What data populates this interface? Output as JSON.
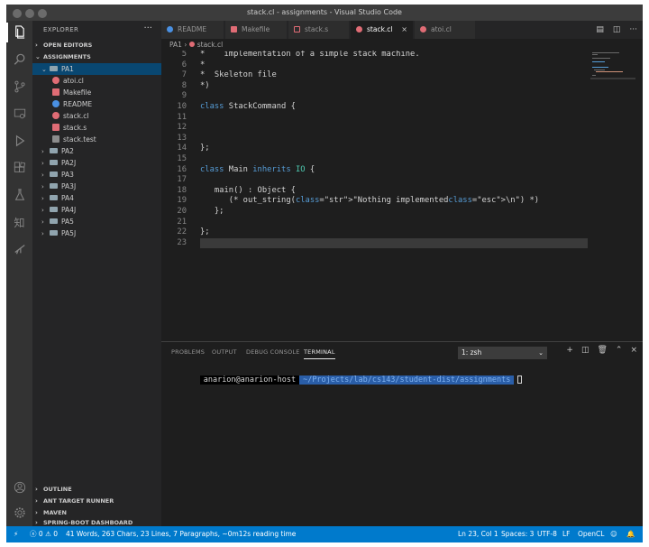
{
  "window": {
    "title": "stack.cl - assignments - Visual Studio Code"
  },
  "sidebar": {
    "title": "EXPLORER",
    "more": "···",
    "sections": {
      "open_editors": "OPEN EDITORS",
      "assignments": "ASSIGNMENTS"
    },
    "tree": [
      {
        "label": "PA1",
        "type": "folder",
        "expanded": true,
        "depth": 1
      },
      {
        "label": "atoi.cl",
        "type": "cool",
        "depth": 2
      },
      {
        "label": "Makefile",
        "type": "makefile",
        "depth": 2
      },
      {
        "label": "README",
        "type": "info",
        "depth": 2
      },
      {
        "label": "stack.cl",
        "type": "cool",
        "depth": 2
      },
      {
        "label": "stack.s",
        "type": "asm",
        "depth": 2
      },
      {
        "label": "stack.test",
        "type": "text",
        "depth": 2
      },
      {
        "label": "PA2",
        "type": "folder",
        "depth": 1
      },
      {
        "label": "PA2J",
        "type": "folder",
        "depth": 1
      },
      {
        "label": "PA3",
        "type": "folder",
        "depth": 1
      },
      {
        "label": "PA3J",
        "type": "folder",
        "depth": 1
      },
      {
        "label": "PA4",
        "type": "folder",
        "depth": 1
      },
      {
        "label": "PA4J",
        "type": "folder",
        "depth": 1
      },
      {
        "label": "PA5",
        "type": "folder",
        "depth": 1
      },
      {
        "label": "PA5J",
        "type": "folder",
        "depth": 1
      }
    ],
    "bottom_sections": [
      "OUTLINE",
      "ANT TARGET RUNNER",
      "MAVEN",
      "SPRING-BOOT DASHBOARD"
    ]
  },
  "tabs": [
    {
      "label": "README",
      "icon": "info-icon",
      "active": false
    },
    {
      "label": "Makefile",
      "icon": "makefile-icon",
      "active": false
    },
    {
      "label": "stack.s",
      "icon": "asm-icon",
      "active": false
    },
    {
      "label": "stack.cl",
      "icon": "cool-file-icon",
      "active": true
    },
    {
      "label": "atoi.cl",
      "icon": "cool-file-icon",
      "active": false
    }
  ],
  "tab_close": "×",
  "breadcrumb": {
    "folder": "PA1",
    "sep": "›",
    "file": "stack.cl"
  },
  "editor": {
    "current_line": 23,
    "lines": [
      {
        "n": "5",
        "text": "*    implementation of a simple stack machine."
      },
      {
        "n": "6",
        "text": "*"
      },
      {
        "n": "7",
        "text": "*  Skeleton file"
      },
      {
        "n": "8",
        "text": "*)"
      },
      {
        "n": "9",
        "text": ""
      },
      {
        "n": "10",
        "text": "class StackCommand {"
      },
      {
        "n": "11",
        "text": ""
      },
      {
        "n": "12",
        "text": ""
      },
      {
        "n": "13",
        "text": ""
      },
      {
        "n": "14",
        "text": "};"
      },
      {
        "n": "15",
        "text": ""
      },
      {
        "n": "16",
        "text": "class Main inherits IO {"
      },
      {
        "n": "17",
        "text": ""
      },
      {
        "n": "18",
        "text": "   main() : Object {"
      },
      {
        "n": "19",
        "text": "      (* out_string(\"Nothing implemented\\n\") *)"
      },
      {
        "n": "20",
        "text": "   };"
      },
      {
        "n": "21",
        "text": ""
      },
      {
        "n": "22",
        "text": "};"
      },
      {
        "n": "23",
        "text": ""
      }
    ]
  },
  "panel": {
    "tabs": [
      "PROBLEMS",
      "OUTPUT",
      "DEBUG CONSOLE",
      "TERMINAL"
    ],
    "active_tab": "TERMINAL",
    "terminal_select": "1: zsh",
    "terminal": {
      "user": "anarion@anarion-host",
      "path": "~/Projects/lab/cs143/student-dist/assignments"
    }
  },
  "statusbar": {
    "remote": "⚡",
    "errors": "0",
    "warnings": "0",
    "stats": "41 Words, 263 Chars, 23 Lines, 7 Paragraphs, ~0m12s reading time",
    "position": "Ln 23, Col 1",
    "spaces": "Spaces: 3",
    "encoding": "UTF-8",
    "eol": "LF",
    "language": "OpenCL"
  },
  "colors": {
    "accent": "#007acc",
    "selection": "#094771",
    "cool_icon": "#e06c75"
  }
}
